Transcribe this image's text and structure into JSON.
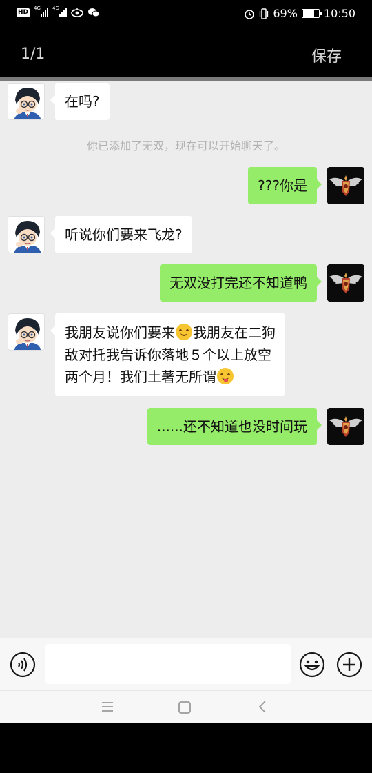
{
  "status_bar": {
    "hd": "HD",
    "signal1": "4G",
    "signal2": "4G",
    "battery": "69%",
    "battery_level": 0.69,
    "time": "10:50",
    "icons": [
      "eye-icon",
      "wechat-icon",
      "alarm-icon",
      "vibrate-icon",
      "battery-icon"
    ]
  },
  "top_bar": {
    "page_count": "1/1",
    "save": "保存"
  },
  "system_message": "你已添加了无双，现在可以开始聊天了。",
  "messages": [
    {
      "side": "left",
      "text": "在吗?"
    },
    {
      "side": "right",
      "text": "???你是"
    },
    {
      "side": "left",
      "text": "听说你们要来飞龙?"
    },
    {
      "side": "right",
      "text": "无双没打完还不知道鸭"
    },
    {
      "side": "left",
      "line1a": "我朋友说你们要来",
      "line1b": "我朋友在二狗",
      "line2": "敌对托我告诉你落地５个以上放空",
      "line3": "两个月！我们土著无所谓",
      "emoji1": "smiling-emoji",
      "emoji2": "winking-tongue-emoji"
    },
    {
      "side": "right",
      "text": "......还不知道也没时间玩"
    }
  ],
  "colors": {
    "chat_background": "#ededed",
    "incoming_bubble": "#ffffff",
    "outgoing_bubble": "#95ec69",
    "system_text": "#b2b2b2"
  }
}
